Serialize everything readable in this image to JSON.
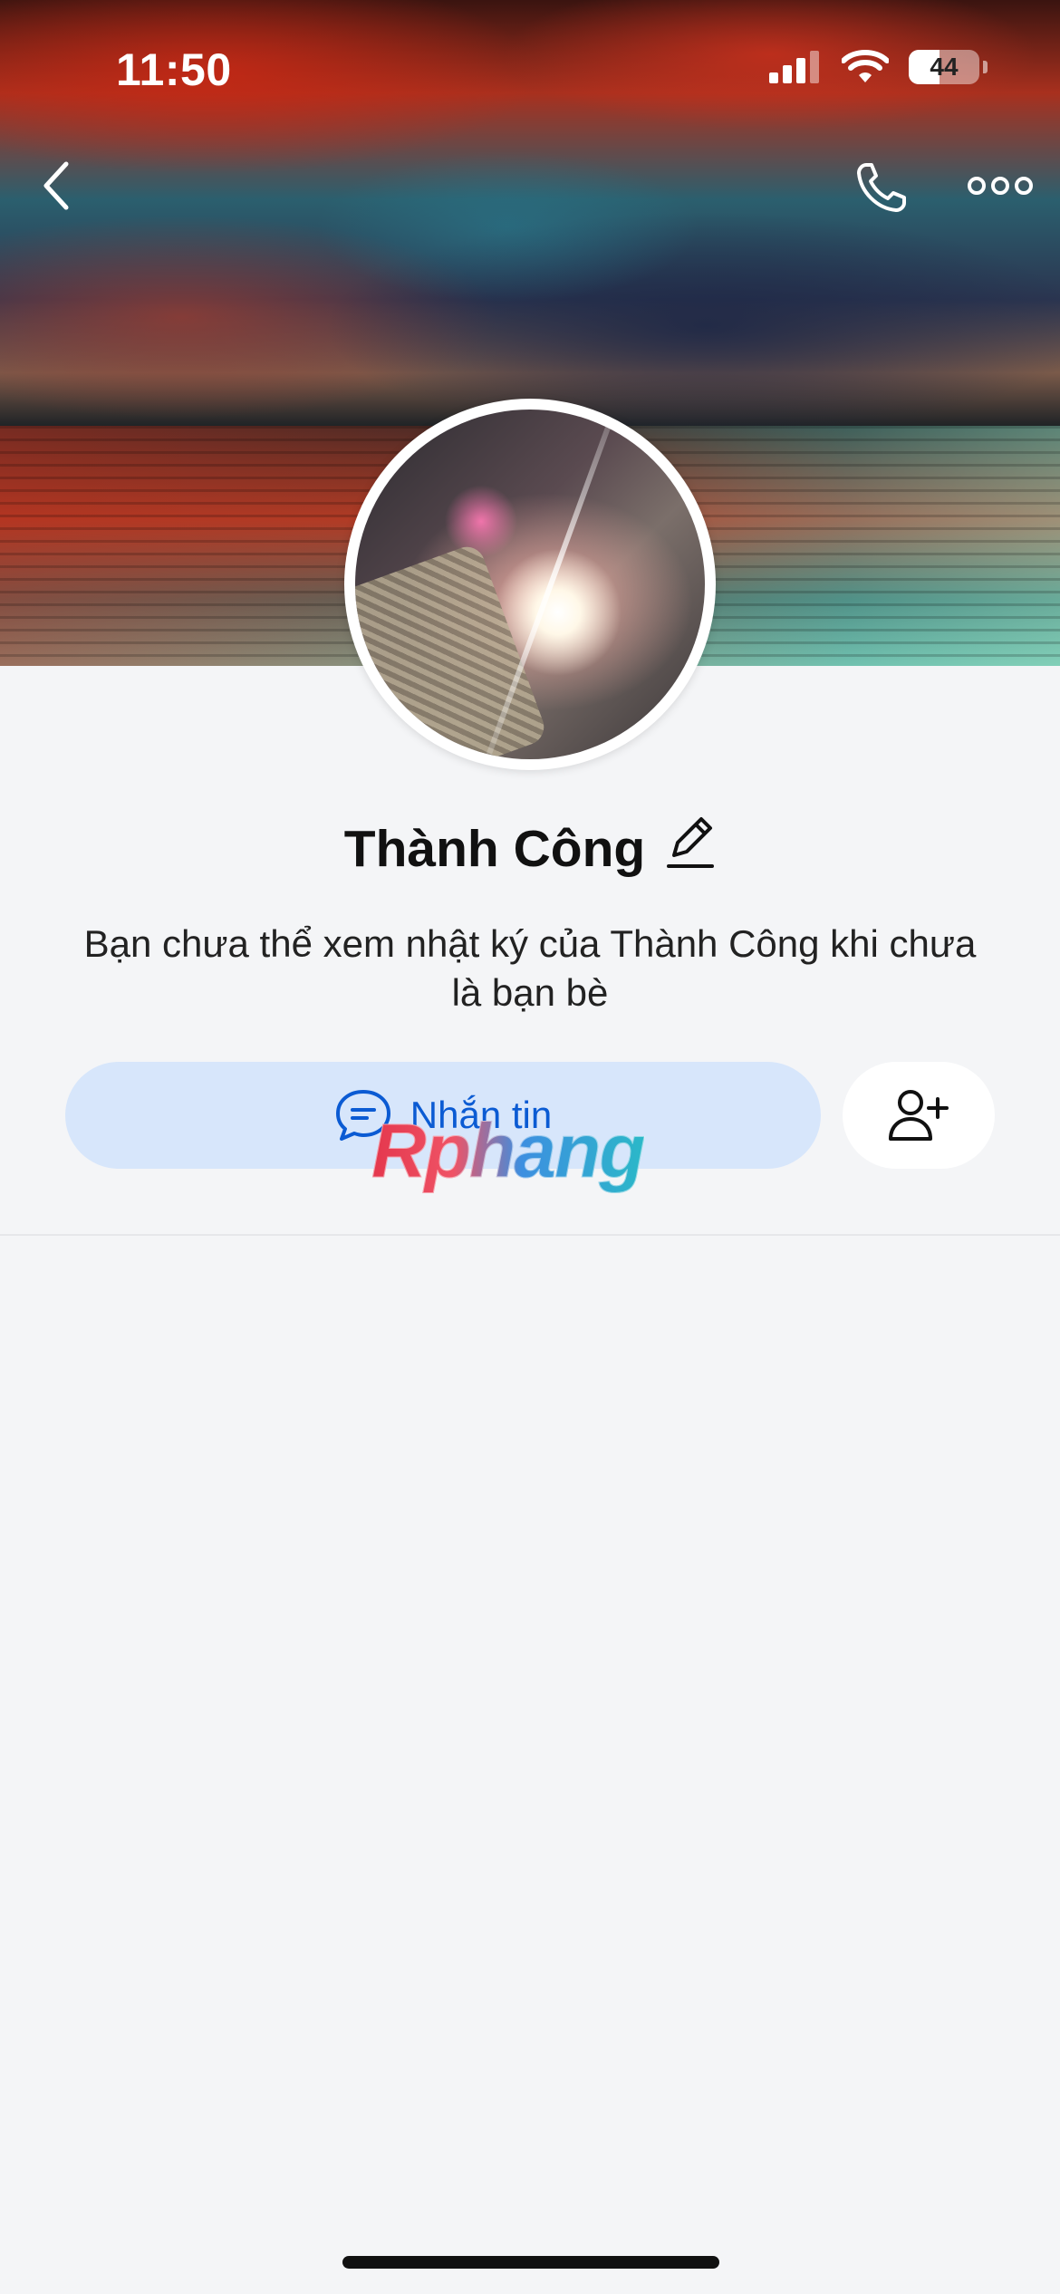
{
  "status_bar": {
    "time": "11:50",
    "battery_level": "44",
    "battery_fraction": 0.44
  },
  "profile": {
    "name": "Thành Công",
    "restriction_message": "Bạn chưa thể xem nhật ký của Thành Công khi chưa là bạn bè"
  },
  "actions": {
    "message_label": "Nhắn tin"
  },
  "watermark": {
    "text": "Rphang"
  },
  "icons": {
    "back": "chevron-left-icon",
    "call": "phone-icon",
    "more": "more-horizontal-icon",
    "edit": "pencil-icon",
    "chat": "chat-bubble-icon",
    "add_friend": "add-user-icon"
  },
  "colors": {
    "accent": "#0b5bd3",
    "button_bg": "#d7e6fb",
    "page_bg": "#f4f5f7"
  }
}
